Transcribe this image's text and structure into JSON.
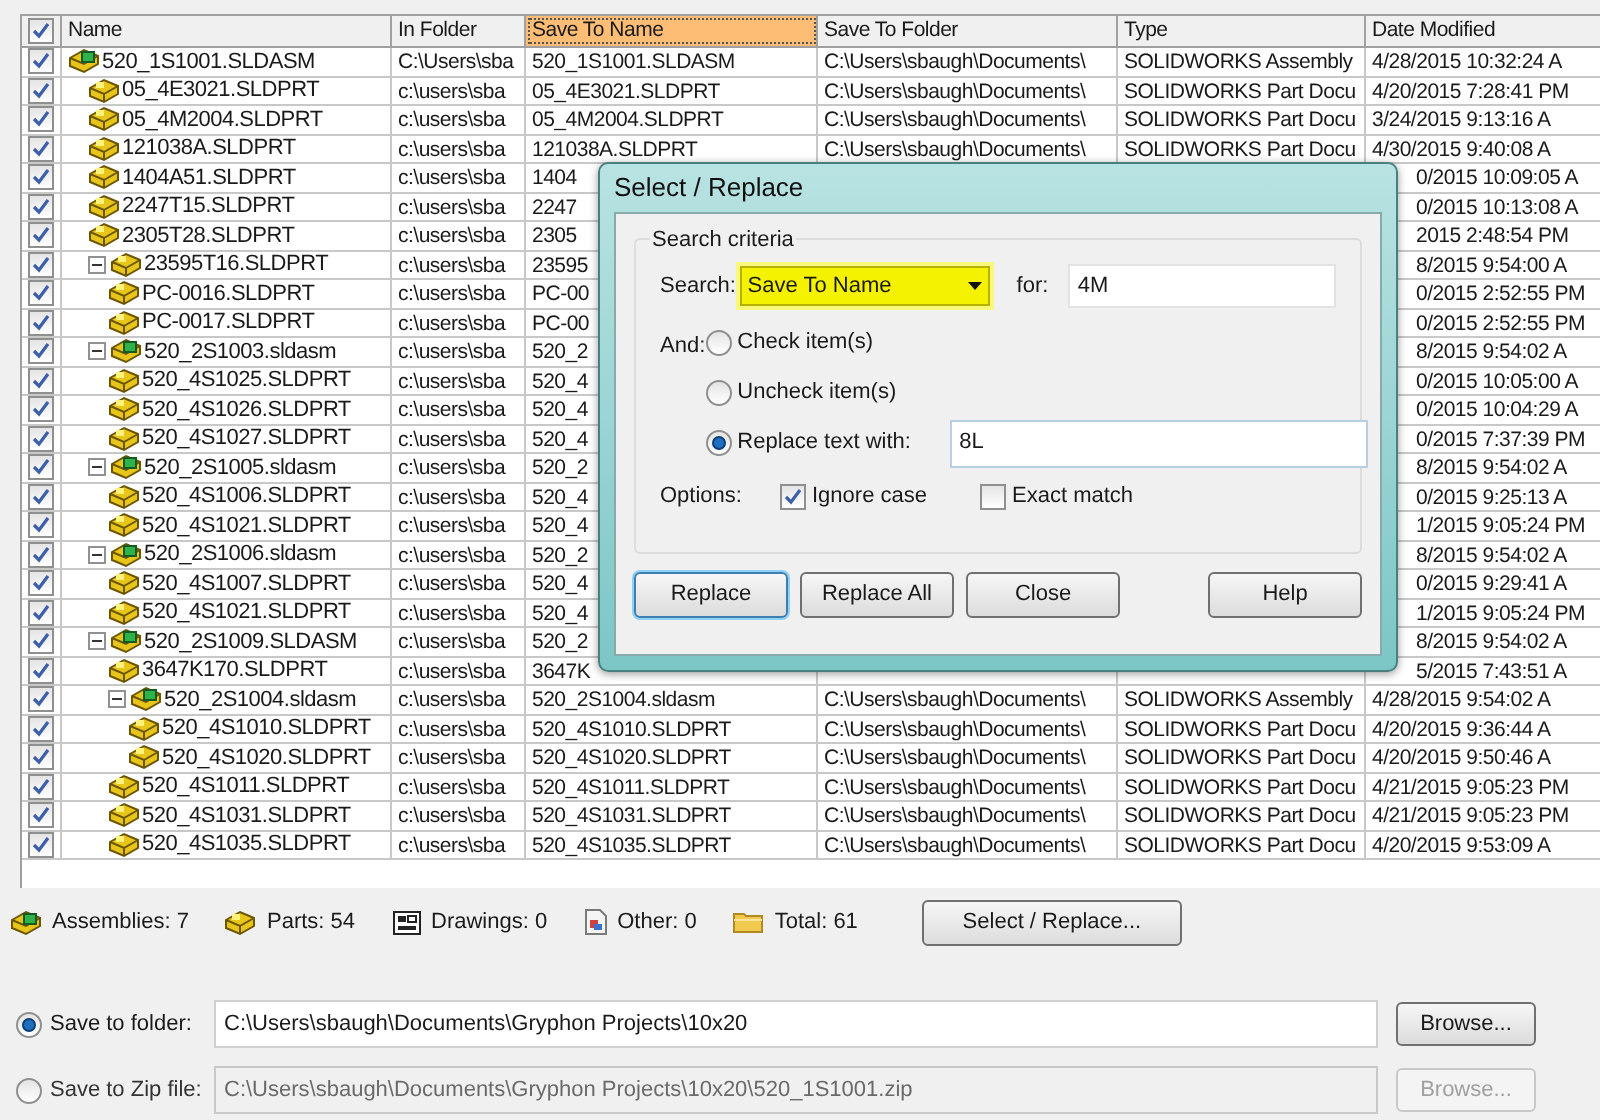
{
  "table": {
    "header_checked": true,
    "columns": [
      {
        "label": "Name",
        "selected": false
      },
      {
        "label": "In Folder",
        "selected": false
      },
      {
        "label": "Save To Name",
        "selected": true
      },
      {
        "label": "Save To Folder",
        "selected": false
      },
      {
        "label": "Type",
        "selected": false
      },
      {
        "label": "Date Modified",
        "selected": false
      }
    ],
    "rows": [
      {
        "kind": "assembly",
        "checked": true,
        "name": "520_1S1001.SLDASM",
        "in_folder": "C:\\Users\\sba",
        "save_to_name": "520_1S1001.SLDASM",
        "save_to_folder": "C:\\Users\\sbaugh\\Documents\\",
        "type": "SOLIDWORKS Assembly",
        "date": "4/28/2015 10:32:24 A",
        "children": [
          {
            "kind": "part",
            "checked": true,
            "name": "05_4E3021.SLDPRT",
            "in_folder": "c:\\users\\sba",
            "save_to_name": "05_4E3021.SLDPRT",
            "save_to_folder": "C:\\Users\\sbaugh\\Documents\\",
            "type": "SOLIDWORKS Part Docu",
            "date": "4/20/2015 7:28:41 PM"
          },
          {
            "kind": "part",
            "checked": true,
            "name": "05_4M2004.SLDPRT",
            "in_folder": "c:\\users\\sba",
            "save_to_name": "05_4M2004.SLDPRT",
            "save_to_folder": "C:\\Users\\sbaugh\\Documents\\",
            "type": "SOLIDWORKS Part Docu",
            "date": "3/24/2015 9:13:16 A"
          },
          {
            "kind": "part",
            "checked": true,
            "name": "121038A.SLDPRT",
            "in_folder": "c:\\users\\sba",
            "save_to_name": "121038A.SLDPRT",
            "save_to_folder": "C:\\Users\\sbaugh\\Documents\\",
            "type": "SOLIDWORKS Part Docu",
            "date": "4/30/2015 9:40:08 A"
          },
          {
            "kind": "part",
            "checked": true,
            "name": "1404A51.SLDPRT",
            "in_folder": "c:\\users\\sba",
            "save_to_name": "1404",
            "date": "0/2015 10:09:05 A"
          },
          {
            "kind": "part",
            "checked": true,
            "name": "2247T15.SLDPRT",
            "in_folder": "c:\\users\\sba",
            "save_to_name": "2247",
            "date": "0/2015 10:13:08 A"
          },
          {
            "kind": "part",
            "checked": true,
            "name": "2305T28.SLDPRT",
            "in_folder": "c:\\users\\sba",
            "save_to_name": "2305",
            "date": "2015 2:48:54 PM"
          },
          {
            "kind": "part",
            "checked": true,
            "expanded": true,
            "name": "23595T16.SLDPRT",
            "in_folder": "c:\\users\\sba",
            "save_to_name": "23595",
            "date": "8/2015 9:54:00 A",
            "children": [
              {
                "kind": "part",
                "checked": true,
                "name": "PC-0016.SLDPRT",
                "in_folder": "c:\\users\\sba",
                "save_to_name": "PC-00",
                "date": "0/2015 2:52:55 PM"
              },
              {
                "kind": "part",
                "checked": true,
                "name": "PC-0017.SLDPRT",
                "in_folder": "c:\\users\\sba",
                "save_to_name": "PC-00",
                "date": "0/2015 2:52:55 PM"
              }
            ]
          },
          {
            "kind": "assembly",
            "checked": true,
            "expanded": true,
            "name": "520_2S1003.sldasm",
            "in_folder": "c:\\users\\sba",
            "save_to_name": "520_2",
            "date": "8/2015 9:54:02 A",
            "children": [
              {
                "kind": "part",
                "checked": true,
                "name": "520_4S1025.SLDPRT",
                "in_folder": "c:\\users\\sba",
                "save_to_name": "520_4",
                "date": "0/2015 10:05:00 A"
              },
              {
                "kind": "part",
                "checked": true,
                "name": "520_4S1026.SLDPRT",
                "in_folder": "c:\\users\\sba",
                "save_to_name": "520_4",
                "date": "0/2015 10:04:29 A"
              },
              {
                "kind": "part",
                "checked": true,
                "name": "520_4S1027.SLDPRT",
                "in_folder": "c:\\users\\sba",
                "save_to_name": "520_4",
                "date": "0/2015 7:37:39 PM"
              }
            ]
          },
          {
            "kind": "assembly",
            "checked": true,
            "expanded": true,
            "name": "520_2S1005.sldasm",
            "in_folder": "c:\\users\\sba",
            "save_to_name": "520_2",
            "date": "8/2015 9:54:02 A",
            "children": [
              {
                "kind": "part",
                "checked": true,
                "name": "520_4S1006.SLDPRT",
                "in_folder": "c:\\users\\sba",
                "save_to_name": "520_4",
                "date": "0/2015 9:25:13 A"
              },
              {
                "kind": "part",
                "checked": true,
                "name": "520_4S1021.SLDPRT",
                "in_folder": "c:\\users\\sba",
                "save_to_name": "520_4",
                "date": "1/2015 9:05:24 PM"
              }
            ]
          },
          {
            "kind": "assembly",
            "checked": true,
            "expanded": true,
            "name": "520_2S1006.sldasm",
            "in_folder": "c:\\users\\sba",
            "save_to_name": "520_2",
            "date": "8/2015 9:54:02 A",
            "children": [
              {
                "kind": "part",
                "checked": true,
                "name": "520_4S1007.SLDPRT",
                "in_folder": "c:\\users\\sba",
                "save_to_name": "520_4",
                "date": "0/2015 9:29:41 A"
              },
              {
                "kind": "part",
                "checked": true,
                "name": "520_4S1021.SLDPRT",
                "in_folder": "c:\\users\\sba",
                "save_to_name": "520_4",
                "date": "1/2015 9:05:24 PM"
              }
            ]
          },
          {
            "kind": "assembly",
            "checked": true,
            "expanded": true,
            "name": "520_2S1009.SLDASM",
            "in_folder": "c:\\users\\sba",
            "save_to_name": "520_2",
            "date": "8/2015 9:54:02 A",
            "children": [
              {
                "kind": "part",
                "checked": true,
                "name": "3647K170.SLDPRT",
                "in_folder": "c:\\users\\sba",
                "save_to_name": "3647K",
                "date": "5/2015 7:43:51 A"
              },
              {
                "kind": "assembly",
                "checked": true,
                "expanded": true,
                "name": "520_2S1004.sldasm",
                "in_folder": "c:\\users\\sba",
                "save_to_name": "520_2S1004.sldasm",
                "save_to_folder": "C:\\Users\\sbaugh\\Documents\\",
                "type": "SOLIDWORKS Assembly",
                "date": "4/28/2015 9:54:02 A",
                "children": [
                  {
                    "kind": "part",
                    "checked": true,
                    "name": "520_4S1010.SLDPRT",
                    "in_folder": "c:\\users\\sba",
                    "save_to_name": "520_4S1010.SLDPRT",
                    "save_to_folder": "C:\\Users\\sbaugh\\Documents\\",
                    "type": "SOLIDWORKS Part Docu",
                    "date": "4/20/2015 9:36:44 A"
                  },
                  {
                    "kind": "part",
                    "checked": true,
                    "name": "520_4S1020.SLDPRT",
                    "in_folder": "c:\\users\\sba",
                    "save_to_name": "520_4S1020.SLDPRT",
                    "save_to_folder": "C:\\Users\\sbaugh\\Documents\\",
                    "type": "SOLIDWORKS Part Docu",
                    "date": "4/20/2015 9:50:46 A"
                  }
                ]
              },
              {
                "kind": "part",
                "checked": true,
                "name": "520_4S1011.SLDPRT",
                "in_folder": "c:\\users\\sba",
                "save_to_name": "520_4S1011.SLDPRT",
                "save_to_folder": "C:\\Users\\sbaugh\\Documents\\",
                "type": "SOLIDWORKS Part Docu",
                "date": "4/21/2015 9:05:23 PM"
              },
              {
                "kind": "part",
                "checked": true,
                "name": "520_4S1031.SLDPRT",
                "in_folder": "c:\\users\\sba",
                "save_to_name": "520_4S1031.SLDPRT",
                "save_to_folder": "C:\\Users\\sbaugh\\Documents\\",
                "type": "SOLIDWORKS Part Docu",
                "date": "4/21/2015 9:05:23 PM"
              },
              {
                "kind": "part",
                "checked": true,
                "name": "520_4S1035.SLDPRT",
                "in_folder": "c:\\users\\sba",
                "save_to_name": "520_4S1035.SLDPRT",
                "save_to_folder": "C:\\Users\\sbaugh\\Documents\\",
                "type": "SOLIDWORKS Part Docu",
                "date": "4/20/2015 9:53:09 A"
              }
            ]
          }
        ]
      }
    ]
  },
  "summary": [
    {
      "kind": "assembly",
      "text": "Assemblies: 7"
    },
    {
      "kind": "part",
      "text": "Parts: 54"
    },
    {
      "kind": "drawing",
      "text": "Drawings: 0"
    },
    {
      "kind": "other",
      "text": "Other: 0"
    },
    {
      "kind": "folder",
      "text": "Total: 61"
    }
  ],
  "select_replace_button": "Select / Replace...",
  "destinations": [
    {
      "label": "Save to folder:",
      "selected": true,
      "disabled": false,
      "value": "C:\\Users\\sbaugh\\Documents\\Gryphon Projects\\10x20",
      "button": "Browse..."
    },
    {
      "label": "Save to Zip file:",
      "selected": false,
      "disabled": true,
      "value": "C:\\Users\\sbaugh\\Documents\\Gryphon Projects\\10x20\\520_1S1001.zip",
      "button": "Browse..."
    }
  ],
  "dialog": {
    "title": "Select / Replace",
    "group": "Search criteria",
    "search_label": "Search:",
    "search_value": "Save To Name",
    "for_label": "for:",
    "for_value": "4M",
    "and_label": "And:",
    "actions": [
      {
        "label": "Check item(s)",
        "selected": false
      },
      {
        "label": "Uncheck item(s)",
        "selected": false
      },
      {
        "label": "Replace text with:",
        "selected": true,
        "value": "8L"
      }
    ],
    "options_label": "Options:",
    "options": [
      {
        "label": "Ignore case",
        "checked": true
      },
      {
        "label": "Exact match",
        "checked": false
      }
    ],
    "buttons": [
      {
        "label": "Replace",
        "default": true
      },
      {
        "label": "Replace All",
        "default": false
      },
      {
        "label": "Close",
        "default": false
      },
      {
        "label": "Help",
        "default": false
      }
    ]
  }
}
